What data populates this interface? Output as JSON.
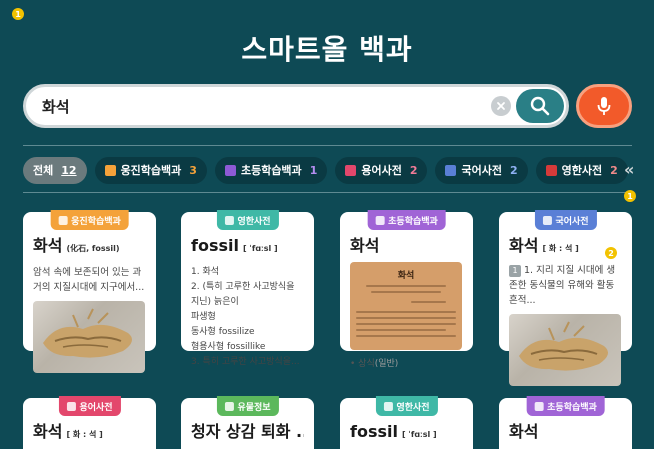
{
  "app": {
    "title": "스마트올 백과",
    "badge_top_left": "1",
    "badge_right": "1",
    "badge_card": "2"
  },
  "search": {
    "value": "화석",
    "placeholder": ""
  },
  "filters": [
    {
      "label": "전체",
      "count": "12",
      "color": "#6b7a7d"
    },
    {
      "label": "웅진학습백과",
      "count": "3",
      "color": "#f4a23a"
    },
    {
      "label": "초등학습백과",
      "count": "1",
      "color": "#8e5ad6"
    },
    {
      "label": "용어사전",
      "count": "2",
      "color": "#e3476c"
    },
    {
      "label": "국어사전",
      "count": "2",
      "color": "#5a7fd6"
    },
    {
      "label": "영한사전",
      "count": "2",
      "color": "#d63a3a"
    }
  ],
  "cards": [
    {
      "tag": "웅진학습백과",
      "tag_color": "#f4a23a",
      "title": "화석",
      "sub": "(化石, fossil)",
      "text": "암석 속에 보존되어 있는 과거의 지질시대에 지구에서..."
    },
    {
      "tag": "영한사전",
      "tag_color": "#3fb8a6",
      "title": "fossil",
      "sub": "[ ˈfɑːsl ]",
      "lines": [
        "1. 화석",
        "2. (특히 고루한 사고방식을",
        "지닌) 늙은이",
        "파생형",
        "동사형 fossilize",
        "형용사형 fossillike",
        "3. 특히 고루한 사고방식을..."
      ]
    },
    {
      "tag": "초등학습백과",
      "tag_color": "#a064d6",
      "title": "화석",
      "doc_title": "화석",
      "caption": "상식",
      "caption_muted": "(일반)"
    },
    {
      "tag": "국어사전",
      "tag_color": "#5a7fd6",
      "title": "화석",
      "sub": "[ 화 : 석 ]",
      "num": "1",
      "text": "1. 지리 지질 시대에 생존한 동식물의 유해와 활동 흔적..."
    },
    {
      "tag": "용어사전",
      "tag_color": "#e3476c",
      "title": "화석",
      "sub": "[ 화 : 석 ]"
    },
    {
      "tag": "유물정보",
      "tag_color": "#5cb85c",
      "title": "청자 상감 퇴화 ..."
    },
    {
      "tag": "영한사전",
      "tag_color": "#3fb8a6",
      "title": "fossil",
      "sub": "[ ˈfɑːsl ]"
    },
    {
      "tag": "초등학습백과",
      "tag_color": "#a064d6",
      "title": "화석"
    }
  ]
}
